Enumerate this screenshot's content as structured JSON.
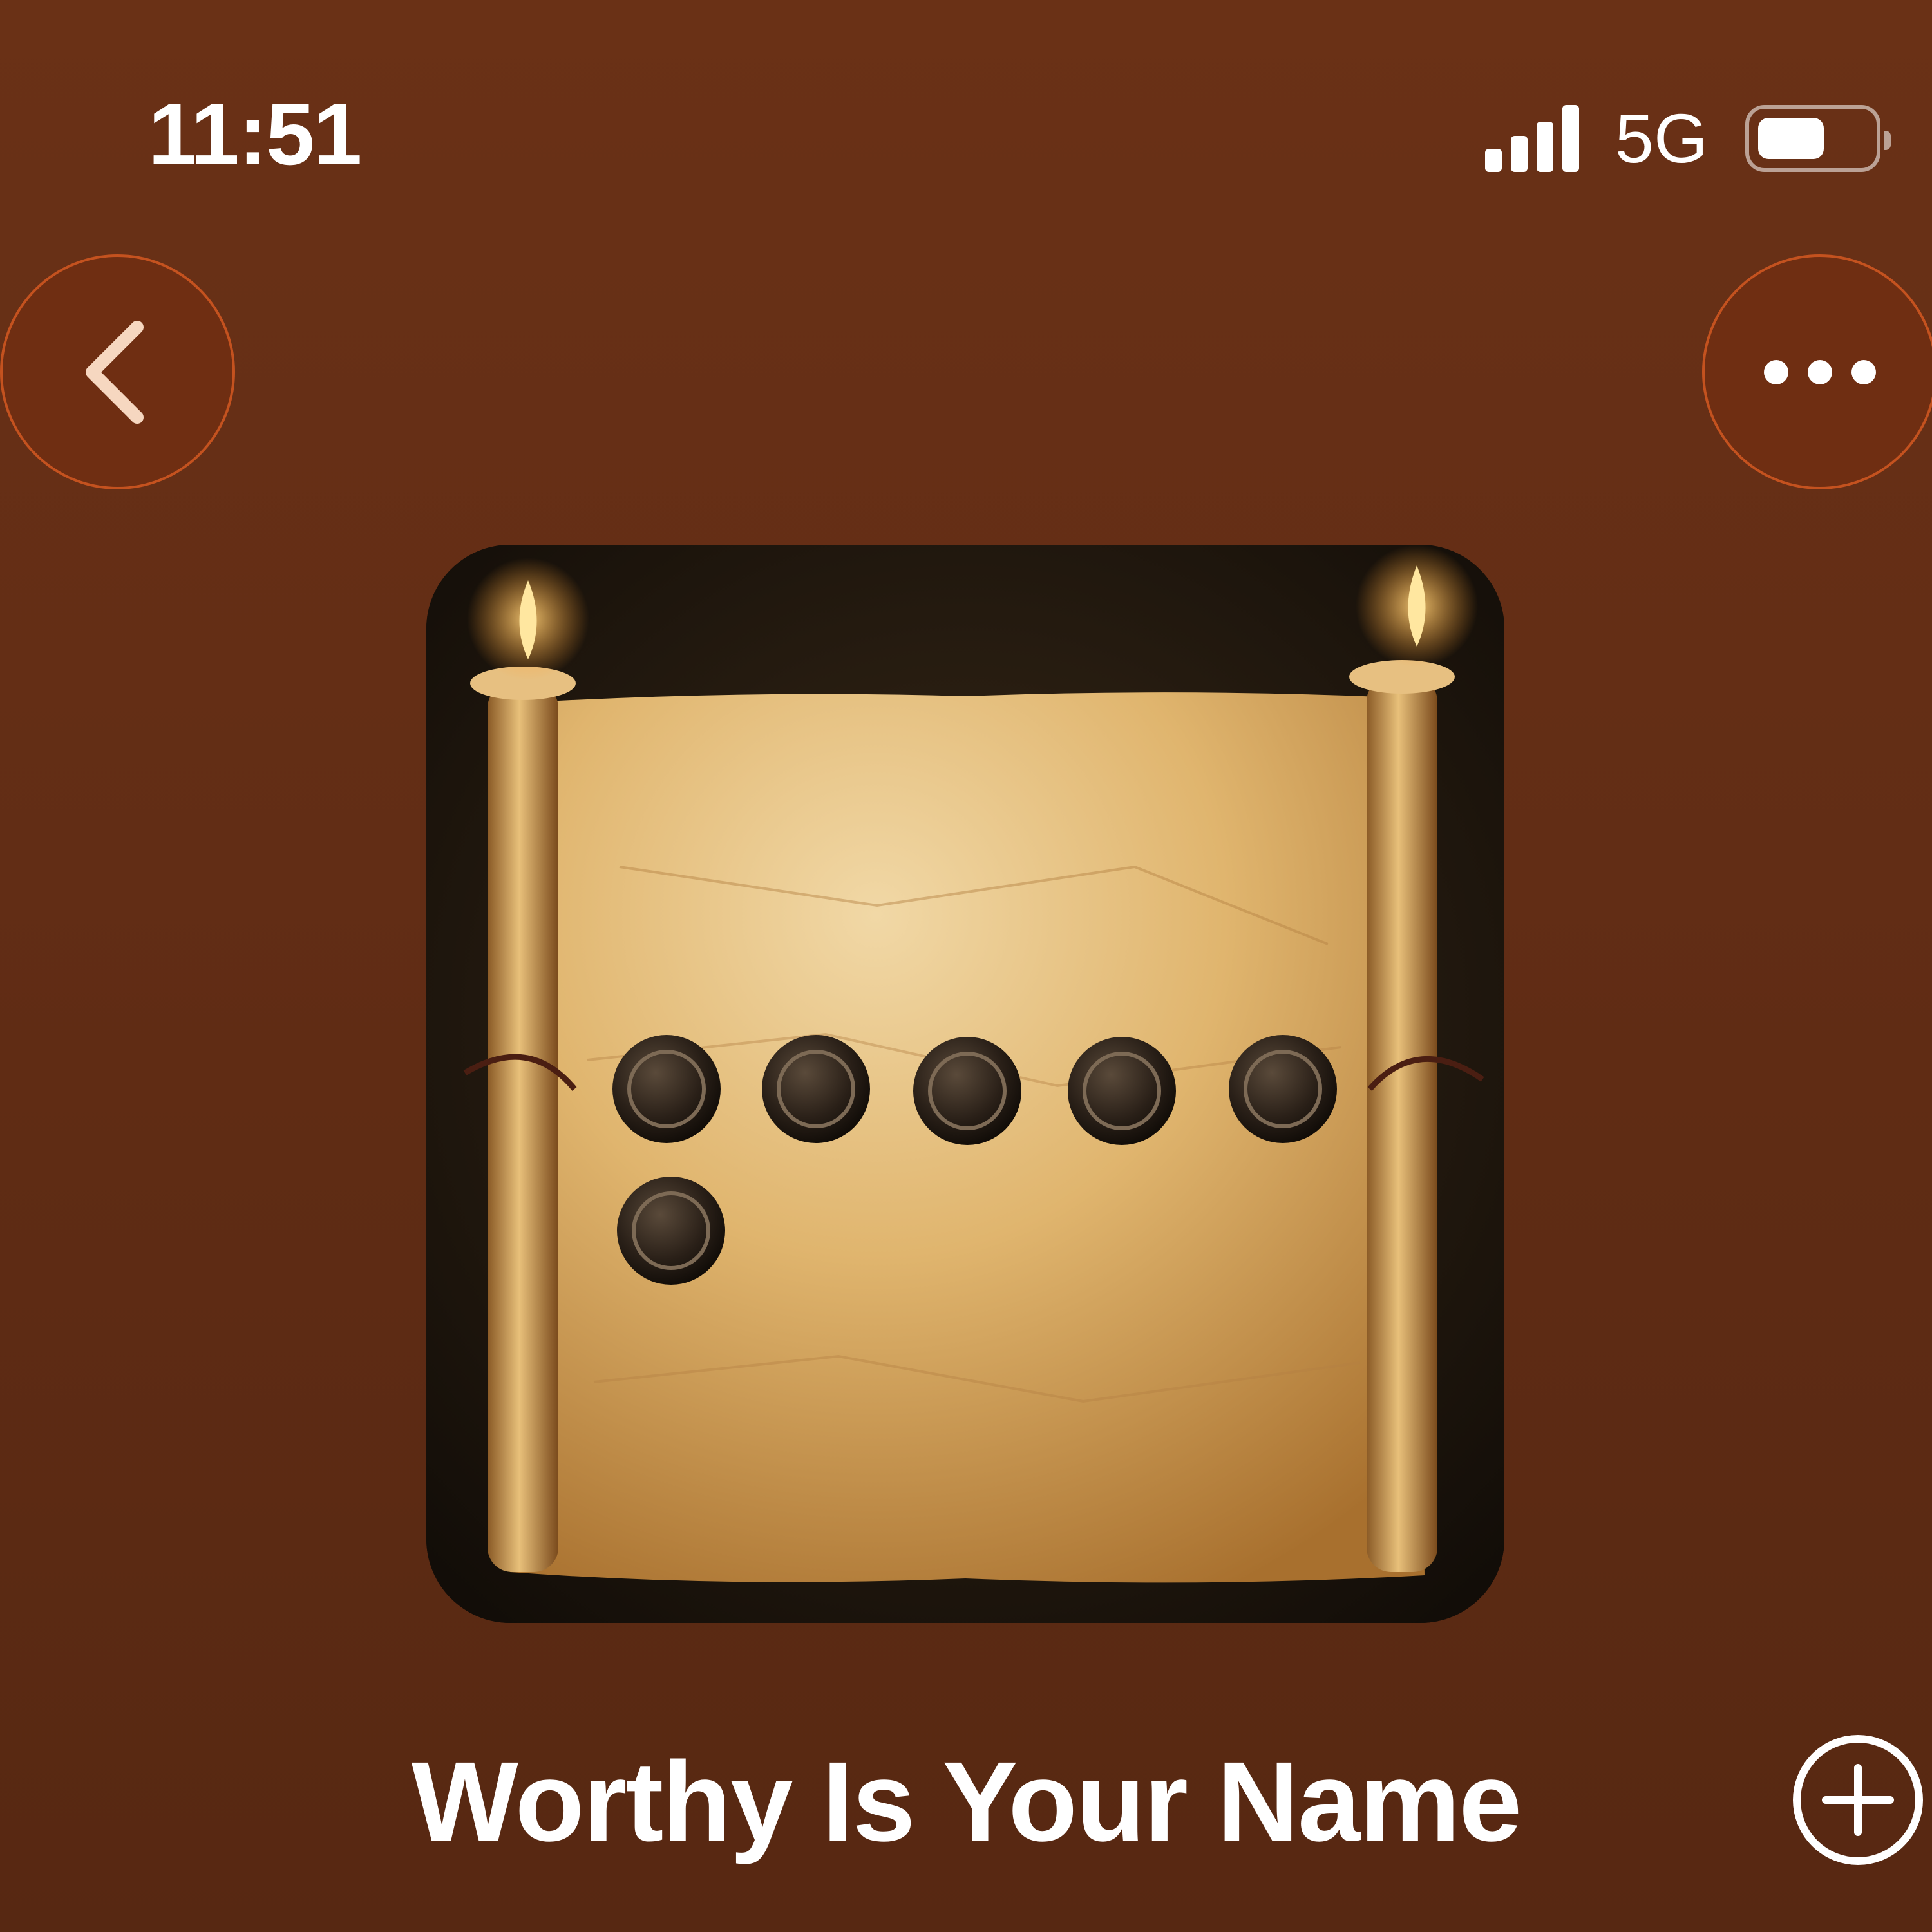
{
  "status_bar": {
    "time": "11:51",
    "network": "5G",
    "signal_bars": 4,
    "battery_level": 0.6,
    "icons": [
      "signal-icon",
      "battery-icon"
    ]
  },
  "nav": {
    "back_icon": "chevron-left-icon",
    "more_icon": "ellipsis-icon"
  },
  "album": {
    "artwork": "scroll-with-seals-artwork",
    "title": "Worthy Is Your Name",
    "add_icon": "plus-circle-icon"
  },
  "colors": {
    "background": "#622d15",
    "button_fill": "#6f2e12",
    "button_border": "#c4521f",
    "icon_tint": "#f6d7c0",
    "text": "#ffffff"
  }
}
